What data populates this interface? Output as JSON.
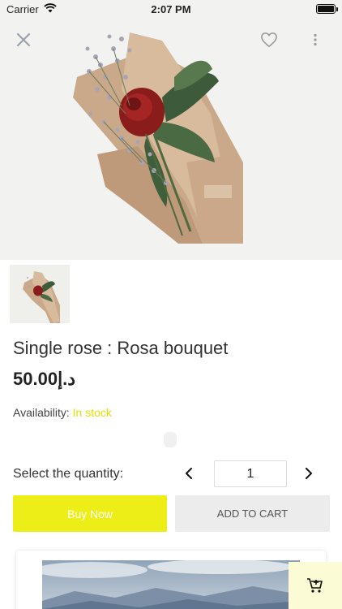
{
  "status": {
    "carrier": "Carrier",
    "time": "2:07 PM",
    "battery_level": 1.0
  },
  "hero": {
    "close_icon": "close-icon",
    "favorite_icon": "heart-outline-icon",
    "more_icon": "more-vertical-icon"
  },
  "product": {
    "title": "Single rose : Rosa bouquet",
    "price": "50.00د.إ",
    "availability_label": "Availability:",
    "availability_value": "In stock",
    "stock_color": "#e3e000"
  },
  "quantity": {
    "label": "Select the quantity:",
    "value": "1",
    "prev_icon": "chevron-left-icon",
    "next_icon": "chevron-right-icon"
  },
  "actions": {
    "buy_now": "Buy Now",
    "add_to_cart": "ADD TO CART",
    "buy_color": "#eded17"
  },
  "fab": {
    "icon": "add-to-cart-icon"
  }
}
